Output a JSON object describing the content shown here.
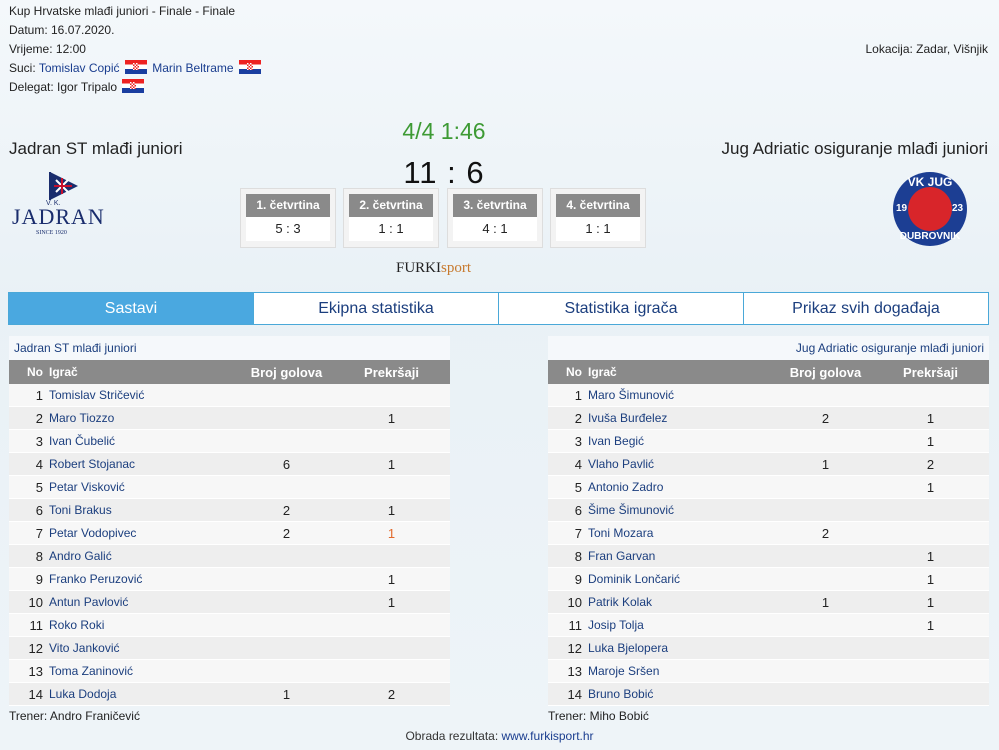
{
  "header": {
    "competition": "Kup Hrvatske mlađi juniori - Finale - Finale",
    "date": "Datum: 16.07.2020.",
    "time": "Vrijeme: 12:00",
    "referees_label": "Suci:",
    "referee_1": "Tomislav Copić",
    "referee_2": "Marin Beltrame",
    "delegate_label": "Delegat:",
    "delegate": "Igor Tripalo",
    "location": "Lokacija: Zadar, Višnjik"
  },
  "match": {
    "home_team": "Jadran ST mlađi juniori",
    "away_team": "Jug Adriatic osiguranje mlađi juniori",
    "period_time": "4/4 1:46",
    "score": "11 : 6",
    "home_logo_top": "V.  K.",
    "home_logo_name": "JADRAN",
    "home_logo_since": "SINCE 1920",
    "away_logo_top": "VK JUG",
    "away_logo_left": "19",
    "away_logo_right": "23",
    "away_logo_bottom": "DUBROVNIK",
    "sponsor_a": "FURKI",
    "sponsor_b": "sport",
    "quarters": [
      {
        "label": "1. četvrtina",
        "score": "5 : 3"
      },
      {
        "label": "2. četvrtina",
        "score": "1 : 1"
      },
      {
        "label": "3. četvrtina",
        "score": "4 : 1"
      },
      {
        "label": "4. četvrtina",
        "score": "1 : 1"
      }
    ]
  },
  "tabs": [
    "Sastavi",
    "Ekipna statistika",
    "Statistika igrača",
    "Prikaz svih događaja"
  ],
  "columns": {
    "no": "No",
    "player": "Igrač",
    "goals": "Broj golova",
    "fouls": "Prekršaji"
  },
  "home": {
    "title": "Jadran ST mlađi juniori",
    "coach": "Trener: Andro Franičević",
    "players": [
      {
        "no": "1",
        "name": "Tomislav Stričević",
        "goals": "",
        "fouls": ""
      },
      {
        "no": "2",
        "name": "Maro Tiozzo",
        "goals": "",
        "fouls": "1"
      },
      {
        "no": "3",
        "name": "Ivan Čubelić",
        "goals": "",
        "fouls": ""
      },
      {
        "no": "4",
        "name": "Robert Stojanac",
        "goals": "6",
        "fouls": "1"
      },
      {
        "no": "5",
        "name": "Petar Visković",
        "goals": "",
        "fouls": ""
      },
      {
        "no": "6",
        "name": "Toni Brakus",
        "goals": "2",
        "fouls": "1"
      },
      {
        "no": "7",
        "name": "Petar Vodopivec",
        "goals": "2",
        "fouls": "1"
      },
      {
        "no": "8",
        "name": "Andro Galić",
        "goals": "",
        "fouls": ""
      },
      {
        "no": "9",
        "name": "Franko Peruzović",
        "goals": "",
        "fouls": "1"
      },
      {
        "no": "10",
        "name": "Antun Pavlović",
        "goals": "",
        "fouls": "1"
      },
      {
        "no": "11",
        "name": "Roko Roki",
        "goals": "",
        "fouls": ""
      },
      {
        "no": "12",
        "name": "Vito Janković",
        "goals": "",
        "fouls": ""
      },
      {
        "no": "13",
        "name": "Toma Zaninović",
        "goals": "",
        "fouls": ""
      },
      {
        "no": "14",
        "name": "Luka Dodoja",
        "goals": "1",
        "fouls": "2"
      }
    ]
  },
  "away": {
    "title": "Jug Adriatic osiguranje mlađi juniori",
    "coach": "Trener: Miho Bobić",
    "players": [
      {
        "no": "1",
        "name": "Maro Šimunović",
        "goals": "",
        "fouls": ""
      },
      {
        "no": "2",
        "name": "Ivuša Burđelez",
        "goals": "2",
        "fouls": "1"
      },
      {
        "no": "3",
        "name": "Ivan Begić",
        "goals": "",
        "fouls": "1"
      },
      {
        "no": "4",
        "name": "Vlaho Pavlić",
        "goals": "1",
        "fouls": "2"
      },
      {
        "no": "5",
        "name": "Antonio Zadro",
        "goals": "",
        "fouls": "1"
      },
      {
        "no": "6",
        "name": "Šime Šimunović",
        "goals": "",
        "fouls": ""
      },
      {
        "no": "7",
        "name": "Toni Mozara",
        "goals": "2",
        "fouls": ""
      },
      {
        "no": "8",
        "name": "Fran Garvan",
        "goals": "",
        "fouls": "1"
      },
      {
        "no": "9",
        "name": "Dominik Lončarić",
        "goals": "",
        "fouls": "1"
      },
      {
        "no": "10",
        "name": "Patrik Kolak",
        "goals": "1",
        "fouls": "1"
      },
      {
        "no": "11",
        "name": "Josip Tolja",
        "goals": "",
        "fouls": "1"
      },
      {
        "no": "12",
        "name": "Luka Bjelopera",
        "goals": "",
        "fouls": ""
      },
      {
        "no": "13",
        "name": "Maroje Sršen",
        "goals": "",
        "fouls": ""
      },
      {
        "no": "14",
        "name": "Bruno Bobić",
        "goals": "",
        "fouls": ""
      }
    ]
  },
  "footer": {
    "label": "Obrada rezultata:",
    "link": "www.furkisport.hr"
  }
}
